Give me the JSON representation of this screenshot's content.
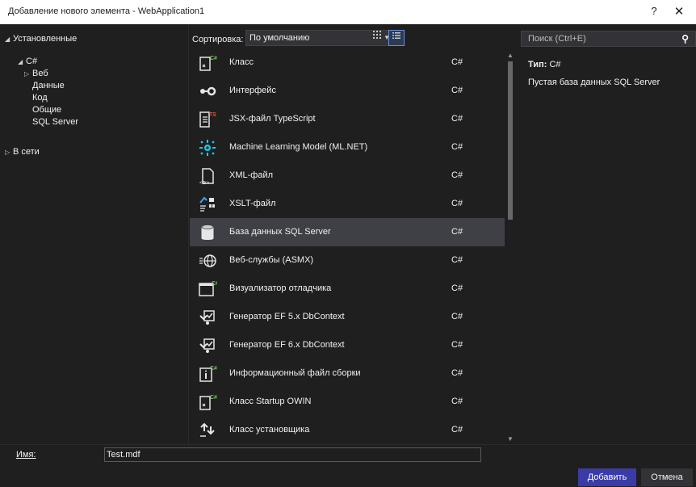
{
  "window": {
    "title": "Добавление нового элемента - WebApplication1",
    "help": "?",
    "close": "✕"
  },
  "tree": {
    "installed": "Установленные",
    "csharp": "C#",
    "web": "Веб",
    "data": "Данные",
    "code": "Код",
    "general": "Общие",
    "sqlserver": "SQL Server",
    "online": "В сети"
  },
  "toolbar": {
    "sort_label": "Сортировка:",
    "sort_value": "По умолчанию"
  },
  "templates": [
    {
      "name": "Класс",
      "lang": "C#",
      "icon": "class-icon"
    },
    {
      "name": "Интерфейс",
      "lang": "C#",
      "icon": "interface-icon"
    },
    {
      "name": "JSX-файл TypeScript",
      "lang": "C#",
      "icon": "typescript-file-icon"
    },
    {
      "name": "Machine Learning Model (ML.NET)",
      "lang": "C#",
      "icon": "ml-model-icon"
    },
    {
      "name": "XML-файл",
      "lang": "C#",
      "icon": "xml-file-icon"
    },
    {
      "name": "XSLT-файл",
      "lang": "C#",
      "icon": "xslt-file-icon"
    },
    {
      "name": "База данных SQL Server",
      "lang": "C#",
      "icon": "database-icon",
      "selected": true
    },
    {
      "name": "Веб-службы (ASMX)",
      "lang": "C#",
      "icon": "web-service-icon"
    },
    {
      "name": "Визуализатор отладчика",
      "lang": "C#",
      "icon": "debugger-visualizer-icon"
    },
    {
      "name": "Генератор EF 5.x DbContext",
      "lang": "C#",
      "icon": "ef-generator-icon"
    },
    {
      "name": "Генератор EF 6.x DbContext",
      "lang": "C#",
      "icon": "ef-generator-icon"
    },
    {
      "name": "Информационный файл сборки",
      "lang": "C#",
      "icon": "assembly-info-icon"
    },
    {
      "name": "Класс Startup OWIN",
      "lang": "C#",
      "icon": "owin-class-icon"
    },
    {
      "name": "Класс установщика",
      "lang": "C#",
      "icon": "installer-class-icon"
    }
  ],
  "details": {
    "search_placeholder": "Поиск (Ctrl+E)",
    "type_label": "Тип:",
    "type_value": "C#",
    "description": "Пустая база данных SQL Server"
  },
  "footer": {
    "name_label": "Имя:",
    "name_value": "Test.mdf",
    "add_label": "Добавить",
    "cancel_label": "Отмена"
  },
  "colors": {
    "accent": "#3b3ba8",
    "selected_row": "#3f3f46",
    "background": "#1f1f1f"
  }
}
